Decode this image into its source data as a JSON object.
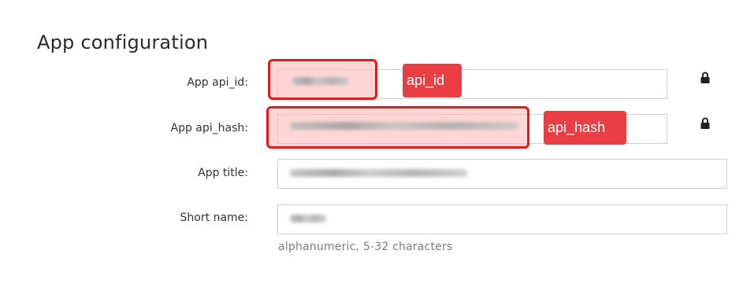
{
  "page": {
    "title": "App configuration"
  },
  "form": {
    "api_id": {
      "label": "App api_id:",
      "value_state": "blurred",
      "lock_icon": "lock-icon",
      "annotation": "api_id"
    },
    "api_hash": {
      "label": "App api_hash:",
      "value_state": "blurred",
      "lock_icon": "lock-icon",
      "annotation": "api_hash"
    },
    "app_title": {
      "label": "App title:",
      "value_state": "blurred"
    },
    "short_name": {
      "label": "Short name:",
      "value_state": "blurred",
      "hint": "alphanumeric, 5-32 characters"
    }
  },
  "colors": {
    "highlight_border": "#e41a1a",
    "highlight_fill": "#ffb4b4",
    "annotation_bg": "#e83e44",
    "field_border": "#cfcfcf",
    "hint_text": "#7a7a7a"
  }
}
